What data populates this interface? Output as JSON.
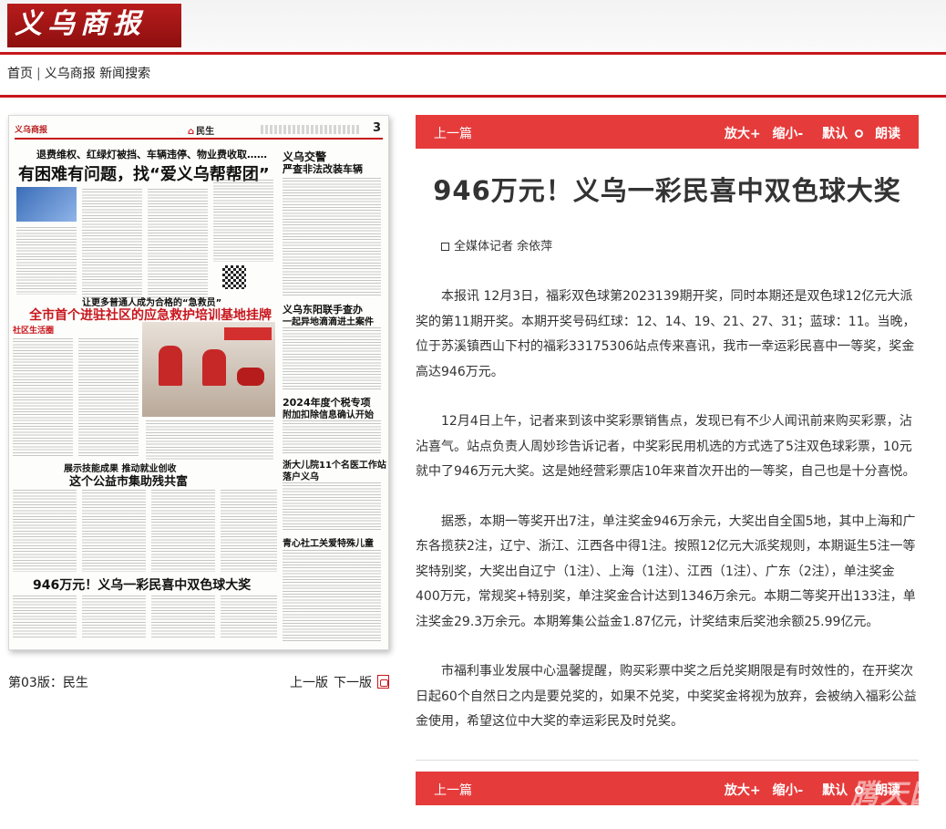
{
  "header": {
    "logo_text": "义乌商报"
  },
  "nav": {
    "home": "首页",
    "paper": "义乌商报",
    "search": "新闻搜索"
  },
  "paper": {
    "masthead": "义乌商报",
    "section": "民生",
    "page_no": "3",
    "headlines": {
      "kicker1": "退费维权、红绿灯被挡、车辆违停、物业费收取……",
      "h1": "有困难有问题，找“爱义乌帮帮团”",
      "side1a": "义乌交警",
      "side1b": "严查非法改装车辆",
      "kicker2": "让更多普通人成为合格的“急救员”",
      "h2": "全市首个进驻社区的应急救护培训基地挂牌",
      "tag": "社区生活圈",
      "side2a": "义乌东阳联手查办",
      "side2b": "一起异地滴滴进土案件",
      "side3a": "2024年度个税专项",
      "side3b": "附加扣除信息确认开始",
      "side4a": "浙大儿院11个名医工作站",
      "side4b": "落户义乌",
      "kicker3": "展示技能成果 推动就业创收",
      "h3": "这个公益市集助残共富",
      "side5": "青心社工关爱特殊儿童",
      "h4": "946万元！义乌一彩民喜中双色球大奖"
    },
    "caption": "第03版：民生",
    "prev_page": "上一版",
    "next_page": "下一版"
  },
  "toolbar": {
    "prev": "上一篇",
    "zoom_in": "放大+",
    "zoom_out": "缩小-",
    "default": "默认",
    "read": "朗读"
  },
  "article": {
    "title": "946万元！义乌一彩民喜中双色球大奖",
    "byline": "全媒体记者 余依萍",
    "p1": "本报讯 12月3日，福彩双色球第2023139期开奖，同时本期还是双色球12亿元大派奖的第11期开奖。本期开奖号码红球：12、14、19、21、27、31；蓝球：11。当晚，位于苏溪镇西山下村的福彩33175306站点传来喜讯，我市一幸运彩民喜中一等奖，奖金高达946万元。",
    "p2": "12月4日上午，记者来到该中奖彩票销售点，发现已有不少人闻讯前来购买彩票，沾沾喜气。站点负责人周妙珍告诉记者，中奖彩民用机选的方式选了5注双色球彩票，10元就中了946万元大奖。这是她经营彩票店10年来首次开出的一等奖，自己也是十分喜悦。",
    "p3": "据悉，本期一等奖开出7注，单注奖金946万余元，大奖出自全国5地，其中上海和广东各揽获2注，辽宁、浙江、江西各中得1注。按照12亿元大派奖规则，本期诞生5注一等奖特别奖，大奖出自辽宁（1注）、上海（1注）、江西（1注）、广东（2注），单注奖金400万元，常规奖+特别奖，单注奖金合计达到1346万余元。本期二等奖开出133注，单注奖金29.3万余元。本期筹集公益金1.87亿元，计奖结束后奖池余额25.99亿元。",
    "p4": "市福利事业发展中心温馨提醒，购买彩票中奖之后兑奖期限是有时效性的，在开奖次日起60个自然日之内是要兑奖的，如果不兑奖，中奖奖金将视为放弃，会被纳入福彩公益金使用，希望这位中大奖的幸运彩民及时兑奖。"
  },
  "watermark": "腾天园"
}
